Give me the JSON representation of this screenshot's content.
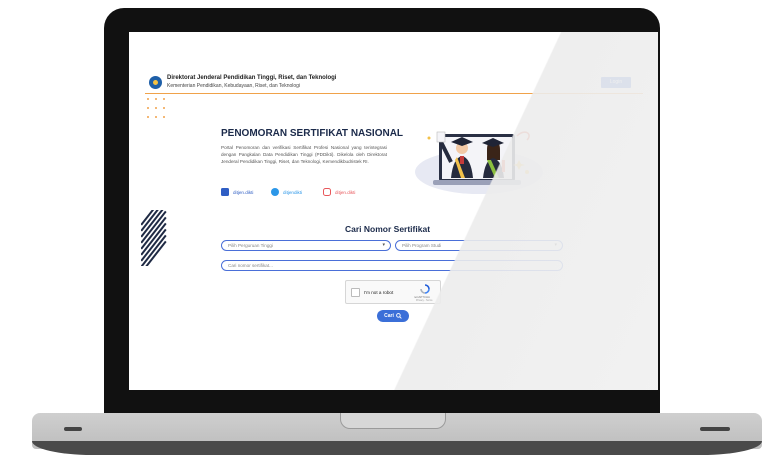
{
  "header": {
    "title": "Direktorat Jenderal Pendidikan Tinggi, Riset, dan Teknologi",
    "subtitle": "Kementerian Pendidikan, Kebudayaan, Riset, dan Teknologi",
    "login_label": "Login"
  },
  "hero": {
    "title": "PENOMORAN SERTIFIKAT NASIONAL",
    "description": "Portal Penomoran dan verifikasi Sertifikat Profesi Nasional yang terintegrasi dengan Pangkalan Data Pendidikan Tinggi (PDDikti). Dikelola oleh Direktorat Jenderal Pendidikan Tinggi, Riset, dan Teknologi, Kemendikbudristek RI.",
    "social": [
      {
        "icon": "facebook-icon",
        "label": "ditjen.dikti",
        "color": "#2f5ec4"
      },
      {
        "icon": "twitter-icon",
        "label": "ditjendikti",
        "color": "#2c97e8"
      },
      {
        "icon": "instagram-icon",
        "label": "ditjen.dikti",
        "color": "#e8575b"
      }
    ]
  },
  "search": {
    "title": "Cari Nomor Sertifikat",
    "university_placeholder": "Pilih Perguruan Tinggi",
    "program_placeholder": "Pilih Program Studi",
    "certificate_placeholder": "Cari nomor sertifikat...",
    "captcha_label": "I'm not a robot",
    "captcha_brand": "reCAPTCHA",
    "captcha_terms": "Privacy - Terms",
    "button_label": "Cari"
  },
  "colors": {
    "primary": "#3b6fd8",
    "accent": "#f0a24a",
    "heading": "#1b2a4a"
  }
}
